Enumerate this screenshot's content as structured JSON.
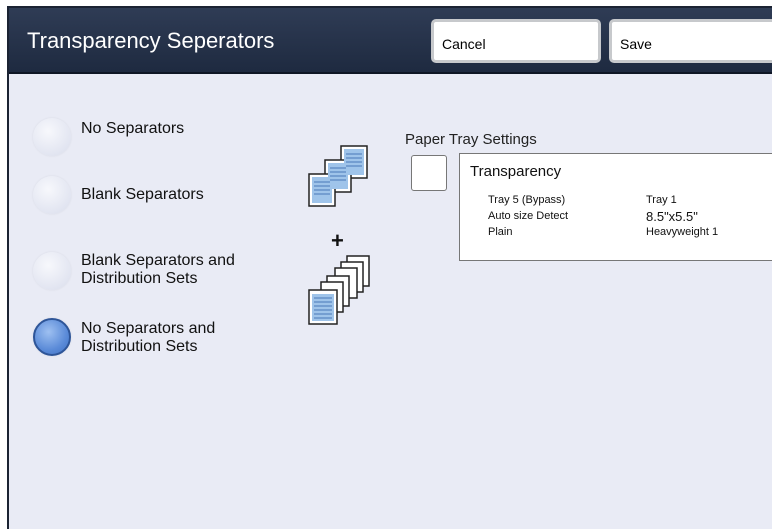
{
  "header": {
    "title": "Transparency Seperators",
    "cancel_label": "Cancel",
    "save_label": "Save"
  },
  "options": [
    {
      "label_lines": [
        "No Separators"
      ],
      "selected": false
    },
    {
      "label_lines": [
        "Blank Separators"
      ],
      "selected": false
    },
    {
      "label_lines": [
        "Blank Separators and",
        "Distribution Sets"
      ],
      "selected": false
    },
    {
      "label_lines": [
        "No Separators and",
        "Distribution Sets"
      ],
      "selected": true
    }
  ],
  "illustration": {
    "plus": "+"
  },
  "paper_tray": {
    "label": "Paper Tray Settings",
    "title": "Transparency",
    "rows": [
      {
        "left": "Tray 5 (Bypass)",
        "right": "Tray 1"
      },
      {
        "left": "Auto size Detect",
        "right": "8.5\"x5.5\""
      },
      {
        "left": "Plain",
        "right": "Heavyweight 1"
      }
    ]
  },
  "colors": {
    "header_bg": "#1e2a40",
    "panel_bg": "#e9ebf5",
    "selected_radio": "#4f7fd0"
  }
}
